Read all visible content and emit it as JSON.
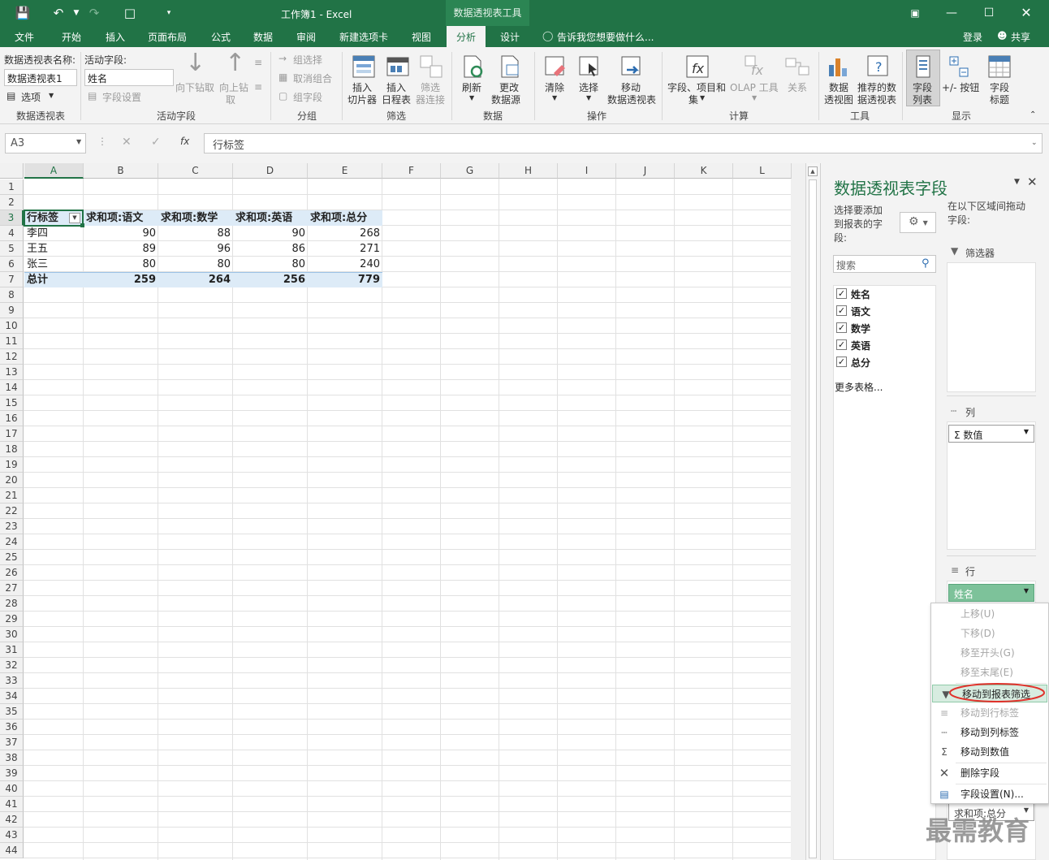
{
  "window": {
    "title": "工作簿1 - Excel",
    "tool_context": "数据透视表工具",
    "login": "登录",
    "share": "共享"
  },
  "tabs": [
    "文件",
    "开始",
    "插入",
    "页面布局",
    "公式",
    "数据",
    "审阅",
    "新建选项卡",
    "视图",
    "分析",
    "设计"
  ],
  "active_tab": "分析",
  "tell_me": "告诉我您想要做什么...",
  "ribbon": {
    "pivot_name_label": "数据透视表名称:",
    "pivot_name_value": "数据透视表1",
    "options": "选项",
    "group_pivot": "数据透视表",
    "active_field_label": "活动字段:",
    "active_field_value": "姓名",
    "field_settings": "字段设置",
    "drill_down": "向下钻取",
    "drill_up": "向上钻",
    "drill_up2": "取",
    "group_active_field": "活动字段",
    "group_selection": "组选择",
    "ungroup": "取消组合",
    "group_field": "组字段",
    "group_group": "分组",
    "insert_slicer_1": "插入",
    "insert_slicer_2": "切片器",
    "insert_timeline_1": "插入",
    "insert_timeline_2": "日程表",
    "filter_conn_1": "筛选",
    "filter_conn_2": "器连接",
    "group_filter": "筛选",
    "refresh": "刷新",
    "change_source_1": "更改",
    "change_source_2": "数据源",
    "group_data": "数据",
    "clear": "清除",
    "select": "选择",
    "move_1": "移动",
    "move_2": "数据透视表",
    "group_actions": "操作",
    "fields_items_1": "字段、项目和",
    "fields_items_2": "集",
    "olap": "OLAP 工具",
    "relations": "关系",
    "group_calc": "计算",
    "pivot_chart_1": "数据",
    "pivot_chart_2": "透视图",
    "recommended_1": "推荐的数",
    "recommended_2": "据透视表",
    "group_tools": "工具",
    "field_list_1": "字段",
    "field_list_2": "列表",
    "buttons": "+/- 按钮",
    "headers_1": "字段",
    "headers_2": "标题",
    "group_show": "显示"
  },
  "formula_bar": {
    "name_box": "A3",
    "formula": "行标签",
    "fx": "fx"
  },
  "columns": [
    "A",
    "B",
    "C",
    "D",
    "E",
    "F",
    "G",
    "H",
    "I",
    "J",
    "K",
    "L"
  ],
  "rows": [
    "1",
    "2",
    "3",
    "4",
    "5",
    "6",
    "7",
    "8",
    "9",
    "10",
    "11",
    "12",
    "13",
    "14",
    "15",
    "16",
    "17",
    "18",
    "19",
    "20",
    "21",
    "22",
    "23",
    "24",
    "25",
    "26",
    "27",
    "28",
    "29",
    "30",
    "31",
    "32",
    "33",
    "34",
    "35",
    "36",
    "37",
    "38",
    "39",
    "40",
    "41",
    "42",
    "43",
    "44"
  ],
  "pivot": {
    "headers": [
      "行标签",
      "求和项:语文",
      "求和项:数学",
      "求和项:英语",
      "求和项:总分"
    ],
    "rows": [
      {
        "name": "李四",
        "values": [
          "90",
          "88",
          "90",
          "268"
        ]
      },
      {
        "name": "王五",
        "values": [
          "89",
          "96",
          "86",
          "271"
        ]
      },
      {
        "name": "张三",
        "values": [
          "80",
          "80",
          "80",
          "240"
        ]
      }
    ],
    "total": {
      "name": "总计",
      "values": [
        "259",
        "264",
        "256",
        "779"
      ]
    }
  },
  "pane": {
    "title": "数据透视表字段",
    "choose_1": "选择要添加",
    "choose_2": "到报表的字",
    "choose_3": "段:",
    "drag_1": "在以下区域间拖动",
    "drag_2": "字段:",
    "search_placeholder": "搜索",
    "fields": [
      "姓名",
      "语文",
      "数学",
      "英语",
      "总分"
    ],
    "more_tables": "更多表格...",
    "filters": "筛选器",
    "columns": "列",
    "columns_item": "数值",
    "rows": "行",
    "rows_item": "姓名",
    "values_item": "求和项:总分"
  },
  "context_menu": {
    "items": [
      "上移(U)",
      "下移(D)",
      "移至开头(G)",
      "移至末尾(E)",
      "移动到报表筛选",
      "移动到行标签",
      "移动到列标签",
      "移动到数值",
      "删除字段",
      "字段设置(N)..."
    ],
    "disabled": [
      true,
      true,
      true,
      true,
      false,
      true,
      false,
      false,
      false,
      false
    ]
  },
  "watermark": "最需教育",
  "colors": {
    "accent": "#217346",
    "highlight": "#ddebf7",
    "annotation": "#e0322b"
  }
}
